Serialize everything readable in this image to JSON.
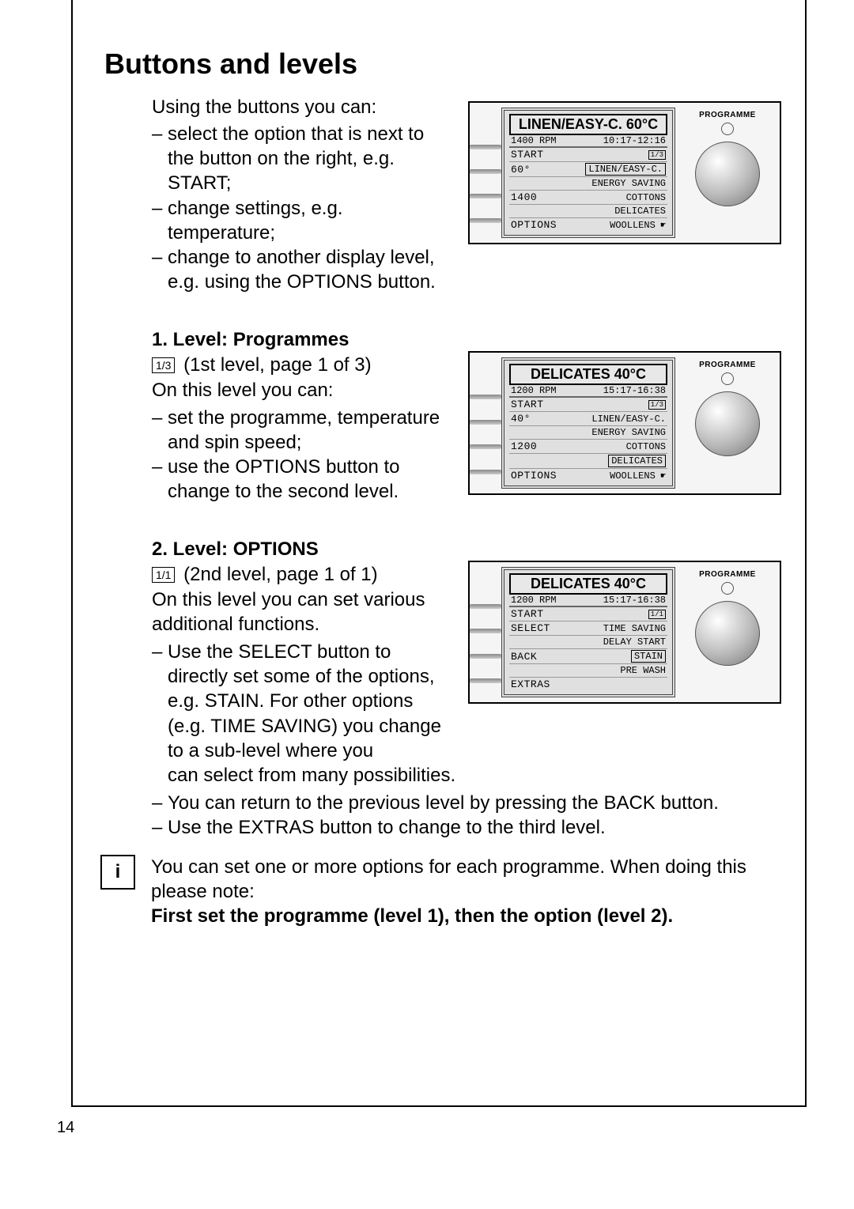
{
  "page_number": "14",
  "heading": "Buttons and levels",
  "intro": "Using the buttons you can:",
  "intro_items": [
    "select the option that is next to the button on the right, e.g. START;",
    "change settings, e.g. temperature;",
    "change to another display level, e.g. using the OPTIONS button."
  ],
  "level1": {
    "title": "1. Level: Programmes",
    "page_ind": "1/3",
    "page_text": "(1st level, page 1 of 3)",
    "lead": "On this level you can:",
    "items": [
      "set the programme, temperature and spin speed;",
      "use the OPTIONS button to change to the second level."
    ]
  },
  "level2": {
    "title": "2. Level: OPTIONS",
    "page_ind": "1/1",
    "page_text": "(2nd level, page 1 of 1)",
    "lead": "On this level you can set various additional functions.",
    "items": [
      "Use the SELECT button to directly set some of the options, e.g. STAIN. For other options (e.g. TIME SAVING) you change to a sub-level where you can select from many possibilities.",
      "You can return to the previous level by pressing the BACK button.",
      "Use the EXTRAS button to change to the third level."
    ],
    "item0_short": "Use the SELECT button to directly set some of the options, e.g. STAIN. For other options (e.g. TIME SAVING) you change to a sub-level where you",
    "item0_rest": "can select from many possibilities."
  },
  "info": {
    "text": "You can set one or more options for each programme. When doing this please note:",
    "bold": "First set the programme (level 1), then the option (level 2)."
  },
  "panel1": {
    "title": "LINEN/EASY-C. 60°C",
    "rpm": "1400 RPM",
    "time": "10:17-12:16",
    "knob_label": "PROGRAMME",
    "rows": [
      {
        "l": "START",
        "r": "1/3",
        "boxed": false,
        "hand": false,
        "mini": true
      },
      {
        "l": "60°",
        "r": "LINEN/EASY-C.",
        "boxed": true,
        "hand": false
      },
      {
        "l": "",
        "r": "ENERGY SAVING",
        "boxed": false,
        "hand": false
      },
      {
        "l": "1400",
        "r": "COTTONS",
        "boxed": false,
        "hand": false
      },
      {
        "l": "",
        "r": "DELICATES",
        "boxed": false,
        "hand": false
      },
      {
        "l": "OPTIONS",
        "r": "WOOLLENS",
        "boxed": false,
        "hand": true
      }
    ]
  },
  "panel2": {
    "title": "DELICATES 40°C",
    "rpm": "1200 RPM",
    "time": "15:17-16:38",
    "knob_label": "PROGRAMME",
    "rows": [
      {
        "l": "START",
        "r": "1/3",
        "mini": true
      },
      {
        "l": "40°",
        "r": "LINEN/EASY-C.",
        "boxed": false
      },
      {
        "l": "",
        "r": "ENERGY SAVING"
      },
      {
        "l": "1200",
        "r": "COTTONS"
      },
      {
        "l": "",
        "r": "DELICATES",
        "boxed": true
      },
      {
        "l": "OPTIONS",
        "r": "WOOLLENS",
        "hand": true
      }
    ]
  },
  "panel3": {
    "title": "DELICATES 40°C",
    "rpm": "1200 RPM",
    "time": "15:17-16:38",
    "knob_label": "PROGRAMME",
    "rows": [
      {
        "l": "START",
        "r": "1/1",
        "mini": true
      },
      {
        "l": "SELECT",
        "r": "TIME SAVING"
      },
      {
        "l": "",
        "r": "DELAY START"
      },
      {
        "l": "BACK",
        "r": "STAIN",
        "boxed": true
      },
      {
        "l": "",
        "r": "PRE WASH"
      },
      {
        "l": "EXTRAS",
        "r": ""
      }
    ]
  }
}
